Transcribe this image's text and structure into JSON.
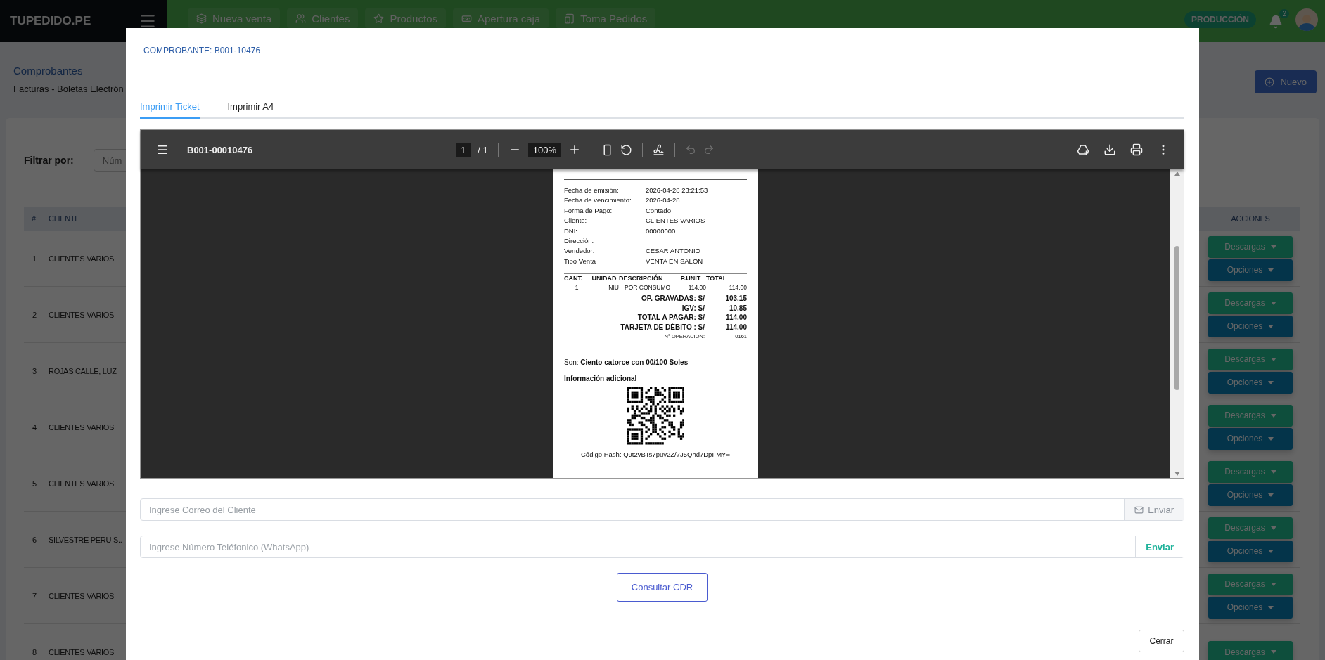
{
  "topbar": {
    "brand": "TUPEDIDO.PE",
    "nav": [
      {
        "label": "Nueva venta"
      },
      {
        "label": "Clientes"
      },
      {
        "label": "Productos"
      },
      {
        "label": "Apertura caja"
      },
      {
        "label": "Toma Pedidos"
      }
    ],
    "env_badge": "PRODUCCIÓN",
    "notifications": "2"
  },
  "page": {
    "breadcrumb": "Comprobantes",
    "subtitle": "Facturas - Boletas Electrón",
    "new_button": "Nuevo",
    "filter_label": "Filtrar por:",
    "filter_placeholder": "Núm",
    "table": {
      "columns": [
        "#",
        "CLIENTE",
        "ACCIONES"
      ],
      "rows": [
        {
          "index": "1",
          "client": "CLIENTES VARIOS",
          "actions": [
            "Descargas",
            "Opciones"
          ]
        },
        {
          "index": "2",
          "client": "CLIENTES VARIOS",
          "actions": [
            "Descargas",
            "Opciones"
          ]
        },
        {
          "index": "3",
          "client": "ROJAS CALLE, LUZ",
          "actions": [
            "Descargas",
            "Opciones"
          ]
        },
        {
          "index": "4",
          "client": "CLIENTES VARIOS",
          "actions": [
            "Descargas",
            "Opciones"
          ]
        },
        {
          "index": "5",
          "client": "CLIENTES VARIOS",
          "actions": [
            "Descargas",
            "Opciones"
          ]
        },
        {
          "index": "6",
          "client": "SILVESTRE PERU S..",
          "actions": [
            "Descargas",
            "Opciones"
          ]
        },
        {
          "index": "7",
          "client": "CLIENTES VARIOS",
          "actions": [
            "Descargas",
            "Opciones"
          ]
        },
        {
          "index": "8",
          "client": "CLIENTES VARIOS",
          "actions": [
            "Descargas"
          ]
        }
      ]
    }
  },
  "modal": {
    "title": "COMPROBANTE: B001-10476",
    "tabs": [
      {
        "label": "Imprimir Ticket",
        "selected": true
      },
      {
        "label": "Imprimir A4",
        "selected": false
      }
    ],
    "viewer": {
      "title": "B001-00010476",
      "page": "1",
      "page_total": "/ 1",
      "zoom": "100%",
      "history_disabled": true
    },
    "receipt": {
      "info": [
        {
          "label": "Fecha de emisión:",
          "value": "2026-04-28 23:21:53"
        },
        {
          "label": "Fecha de vencimiento:",
          "value": "2026-04-28"
        },
        {
          "label": "Forma de Pago:",
          "value": "Contado"
        },
        {
          "label": "Cliente:",
          "value": "CLIENTES VARIOS"
        },
        {
          "label": "DNI:",
          "value": "00000000"
        },
        {
          "label": "Dirección:"
        },
        {
          "label": "Vendedor:",
          "value": "CESAR ANTONIO"
        },
        {
          "label": "Tipo Venta",
          "value": "VENTA EN SALON"
        }
      ],
      "columns": [
        "CANT.",
        "UNIDAD",
        "DESCRIPCIÓN",
        "P.UNIT",
        "TOTAL"
      ],
      "items": [
        [
          "1",
          "NIU",
          "POR CONSUMO",
          "114.00",
          "114.00"
        ]
      ],
      "totals": [
        {
          "kind": "total",
          "label": "OP. GRAVADAS: S/",
          "value": "103.15"
        },
        {
          "kind": "total",
          "label": "IGV: S/",
          "value": "10.85"
        },
        {
          "kind": "total",
          "label": "TOTAL A PAGAR: S/",
          "value": "114.00"
        },
        {
          "kind": "total",
          "label": "TARJETA DE DÉBITO : S/",
          "value": "114.00"
        },
        {
          "kind": "note",
          "label": "N° OPERACION:",
          "value": "0161"
        }
      ],
      "amount_words": "Son: **Ciento catorce con 00/100 Soles**",
      "additional_title": "Información adicional",
      "hash": "Código Hash: Q9t2vBTs7puv2Z/7J5Qhd7DpFMY="
    },
    "contact_fields": [
      {
        "kind": "email",
        "placeholder": "Ingrese Correo del Cliente",
        "button": "Enviar"
      },
      {
        "kind": "whatsapp",
        "placeholder": "Ingrese Número Teléfonico (WhatsApp)",
        "button": "Enviar"
      }
    ],
    "cdr_button": "Consultar CDR",
    "close_button": "Cerrar"
  }
}
